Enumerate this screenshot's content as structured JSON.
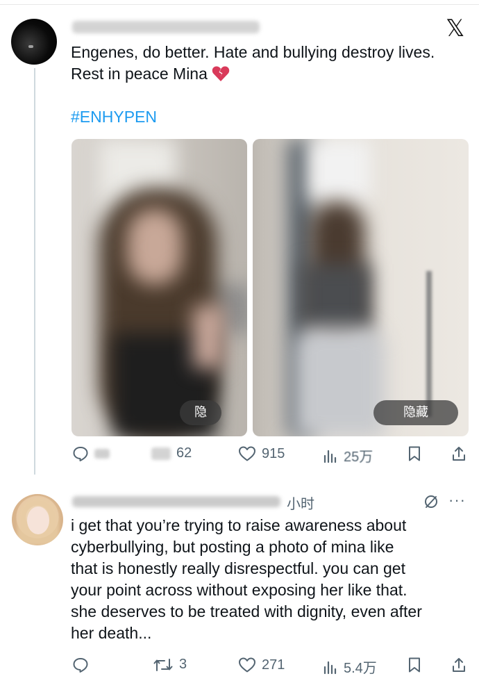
{
  "brand_logo": "𝕏",
  "tweet1": {
    "text_line1": "Engenes, do better. Hate and bullying destroy lives.",
    "text_line2": "Rest in peace Mina",
    "emoji": "broken-heart",
    "hashtag": "#ENHYPEN",
    "image1_hide_label": "隐",
    "image2_hide_label": "隐藏",
    "stats": {
      "retweets": "62",
      "likes": "915",
      "views": "25万"
    }
  },
  "reply": {
    "time": "小时",
    "lines": [
      "i get that you’re trying to raise awareness about",
      "cyberbullying, but posting a photo of mina like",
      "that is honestly really disrespectful. you can get",
      "your point across without exposing her like that.",
      "she deserves to be treated with dignity, even after",
      "her death..."
    ],
    "more": "···",
    "stats": {
      "retweets": "3",
      "likes": "271",
      "views": "5.4万"
    }
  },
  "colors": {
    "link": "#1d9bf0",
    "muted": "#536471",
    "text": "#0f1419",
    "heart_emoji": "#d93a5a"
  }
}
